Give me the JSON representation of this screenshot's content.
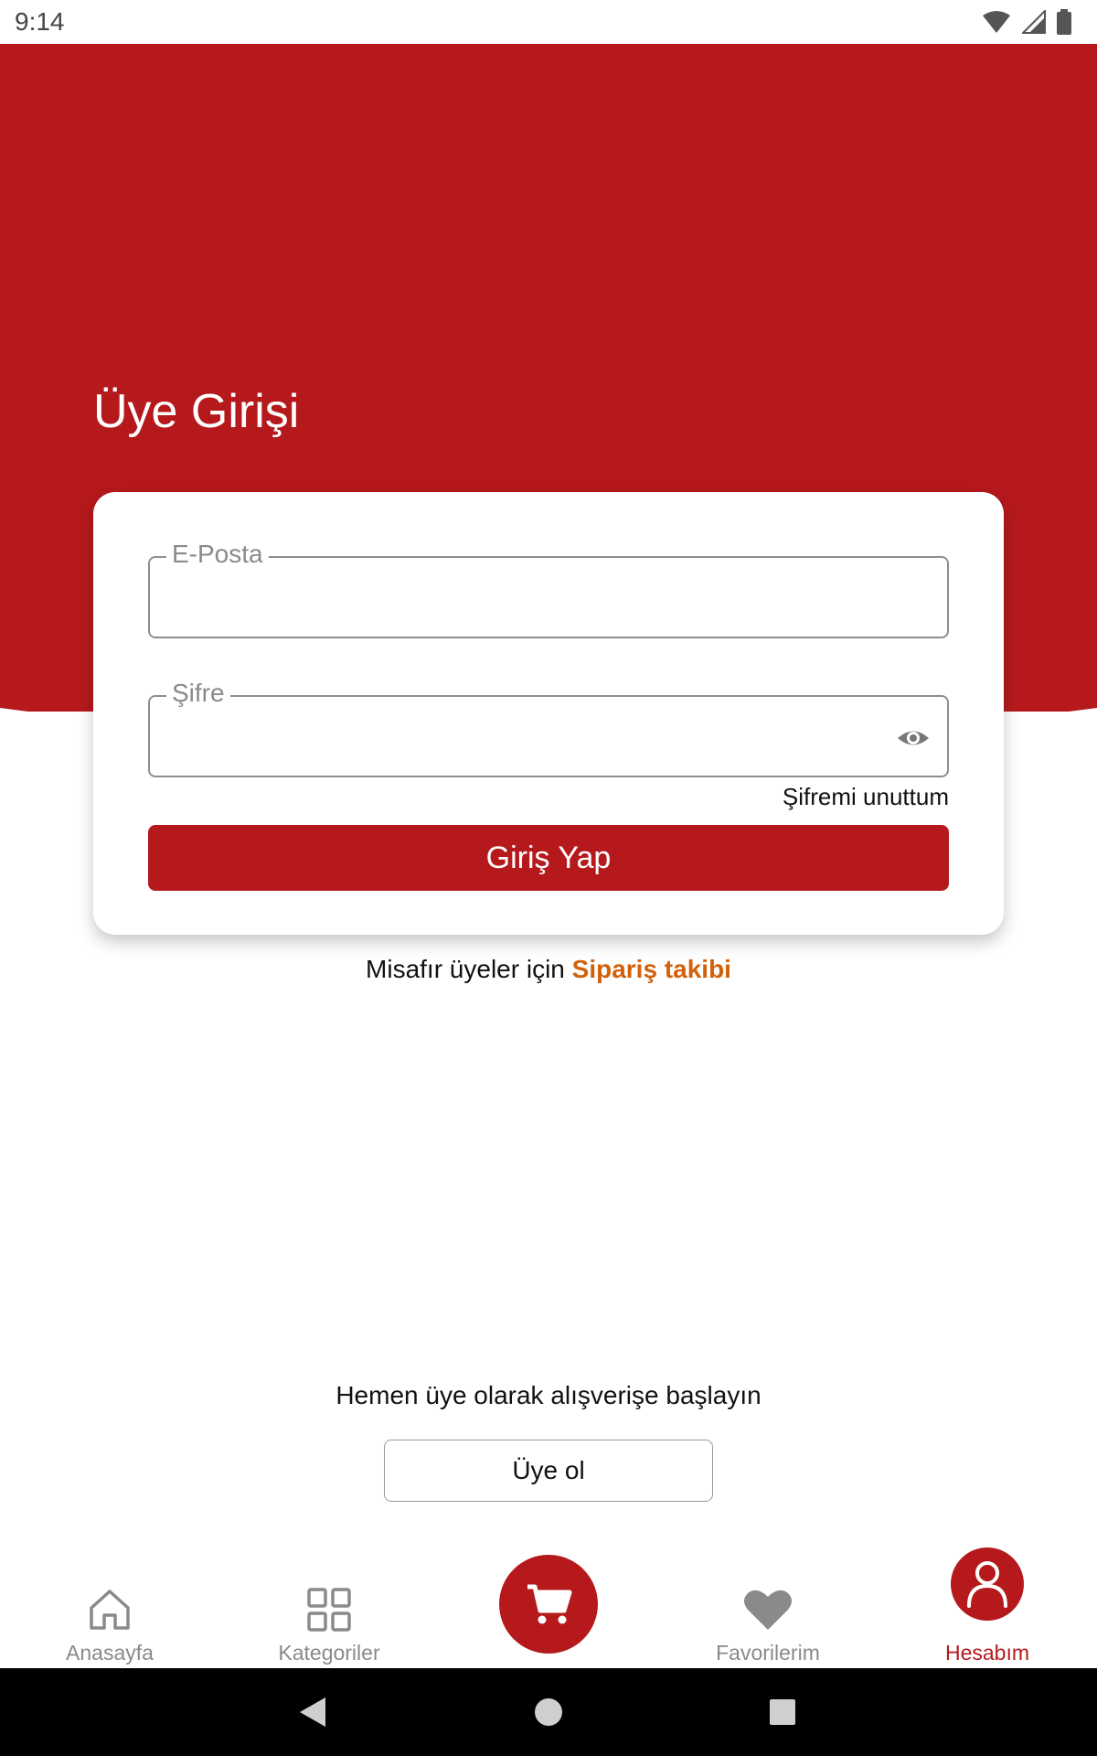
{
  "status_bar": {
    "time": "9:14",
    "icons": [
      "wifi-icon",
      "signal-icon",
      "battery-icon"
    ]
  },
  "colors": {
    "brand_red": "#b5191c",
    "accent_orange": "#d2600a",
    "nav_inactive": "#8a8a8a"
  },
  "header": {
    "title": "Üye Girişi"
  },
  "login_form": {
    "email": {
      "label": "E-Posta",
      "value": ""
    },
    "password": {
      "label": "Şifre",
      "value": "",
      "toggle_icon": "eye-icon"
    },
    "forgot_password": "Şifremi unuttum",
    "submit_label": "Giriş Yap"
  },
  "guest": {
    "prefix": "Misafır üyeler için",
    "link": "Sipariş takibi"
  },
  "signup": {
    "prompt": "Hemen üye olarak alışverişe başlayın",
    "button_label": "Üye ol"
  },
  "bottom_nav": {
    "items": [
      {
        "label": "Anasayfa",
        "icon": "home-icon",
        "active": false
      },
      {
        "label": "Kategoriler",
        "icon": "grid-icon",
        "active": false
      },
      {
        "label": "",
        "icon": "cart-icon",
        "active": false
      },
      {
        "label": "Favorilerim",
        "icon": "heart-icon",
        "active": false
      },
      {
        "label": "Hesabım",
        "icon": "person-icon",
        "active": true
      }
    ]
  },
  "system_nav": {
    "buttons": [
      "back-icon",
      "home-circle-icon",
      "recents-icon"
    ]
  }
}
